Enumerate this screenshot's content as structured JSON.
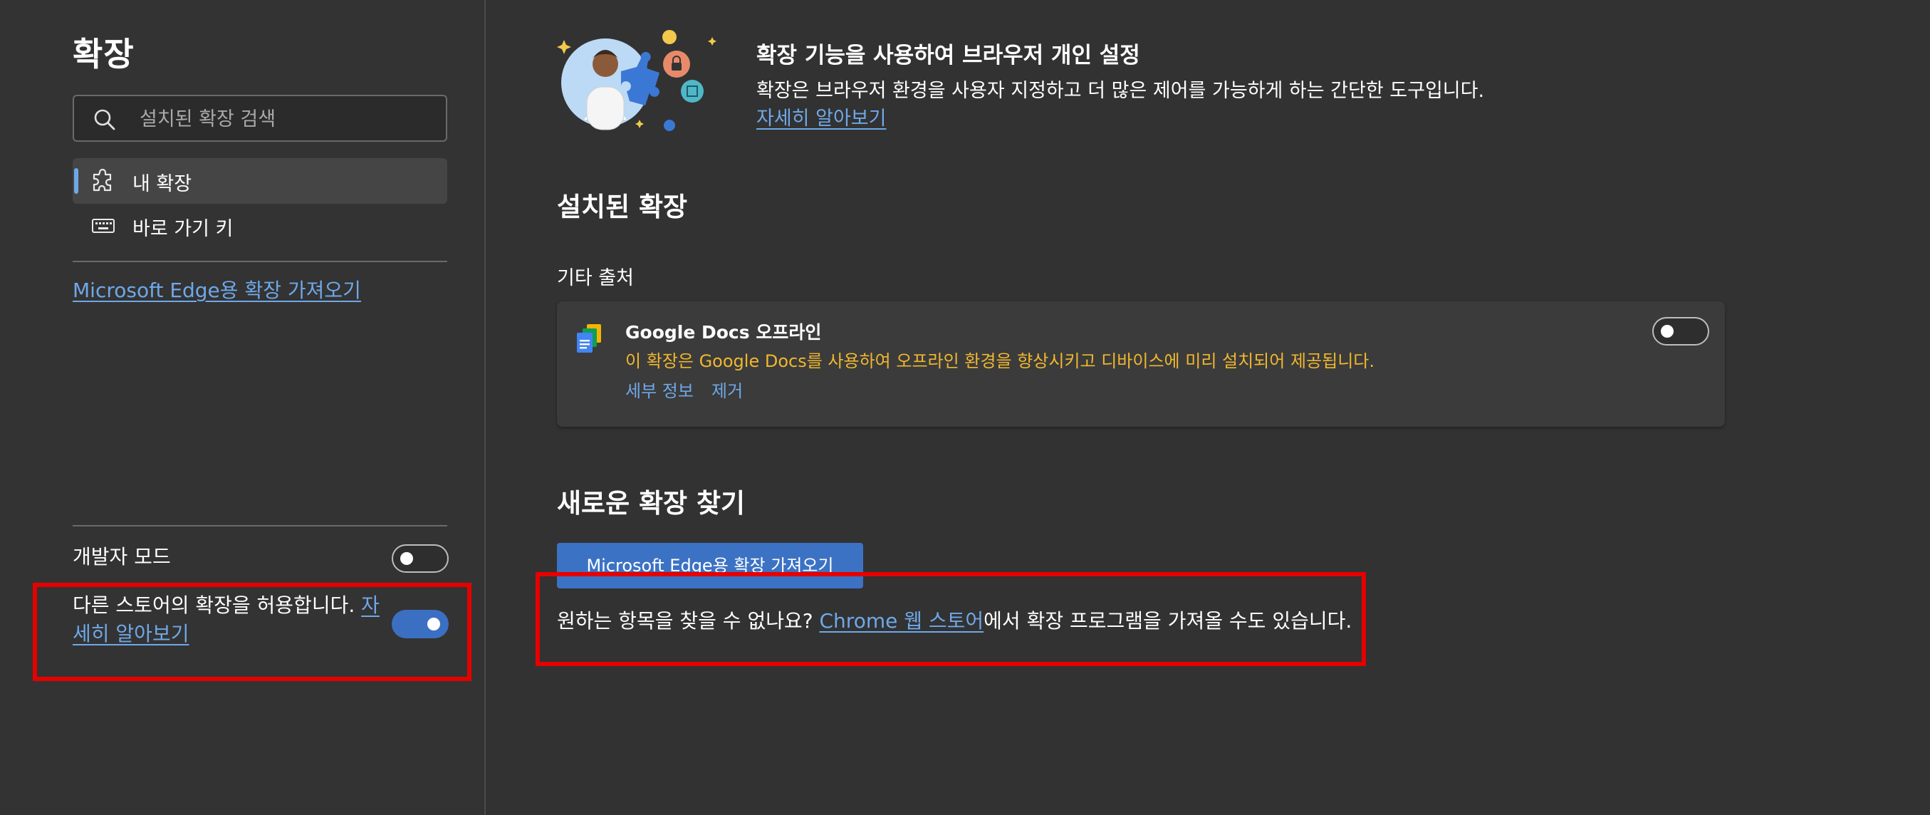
{
  "sidebar": {
    "title": "확장",
    "search_placeholder": "설치된 확장 검색",
    "nav": [
      {
        "label": "내 확장",
        "icon": "puzzle-icon",
        "selected": true
      },
      {
        "label": "바로 가기 키",
        "icon": "keyboard-icon",
        "selected": false
      }
    ],
    "ms_edge_link": "Microsoft Edge용 확장 가져오기",
    "dev_mode_label": "개발자 모드",
    "dev_mode_on": false,
    "other_stores_text": "다른 스토어의 확장을 허용합니다. ",
    "other_stores_link": "자세히 알아보기",
    "other_stores_on": true
  },
  "hero": {
    "title": "확장 기능을 사용하여 브라우저 개인 설정",
    "description": "확장은 브라우저 환경을 사용자 지정하고 더 많은 제어를 가능하게 하는 간단한 도구입니다.",
    "link": "자세히 알아보기"
  },
  "installed": {
    "title": "설치된 확장",
    "section_label": "기타 출처",
    "extensions": [
      {
        "name": "Google Docs 오프라인",
        "description": "이 확장은 Google Docs를 사용하여 오프라인 환경을 향상시키고 디바이스에 미리 설치되어 제공됩니다.",
        "details": "세부 정보",
        "remove": "제거",
        "enabled": false,
        "icon": "google-docs-icon"
      }
    ]
  },
  "find": {
    "title": "새로운 확장 찾기",
    "button": "Microsoft Edge용 확장 가져오기",
    "chrome_prefix": "원하는 항목을 찾을 수 없나요? ",
    "chrome_link": "Chrome 웹 스토어",
    "chrome_suffix": "에서 확장 프로그램을 가져올 수도 있습니다."
  },
  "colors": {
    "background": "#323232",
    "link": "#6fa8e8",
    "accent": "#3b6fc2",
    "warning": "#f0b72f",
    "highlight": "#e60000"
  }
}
